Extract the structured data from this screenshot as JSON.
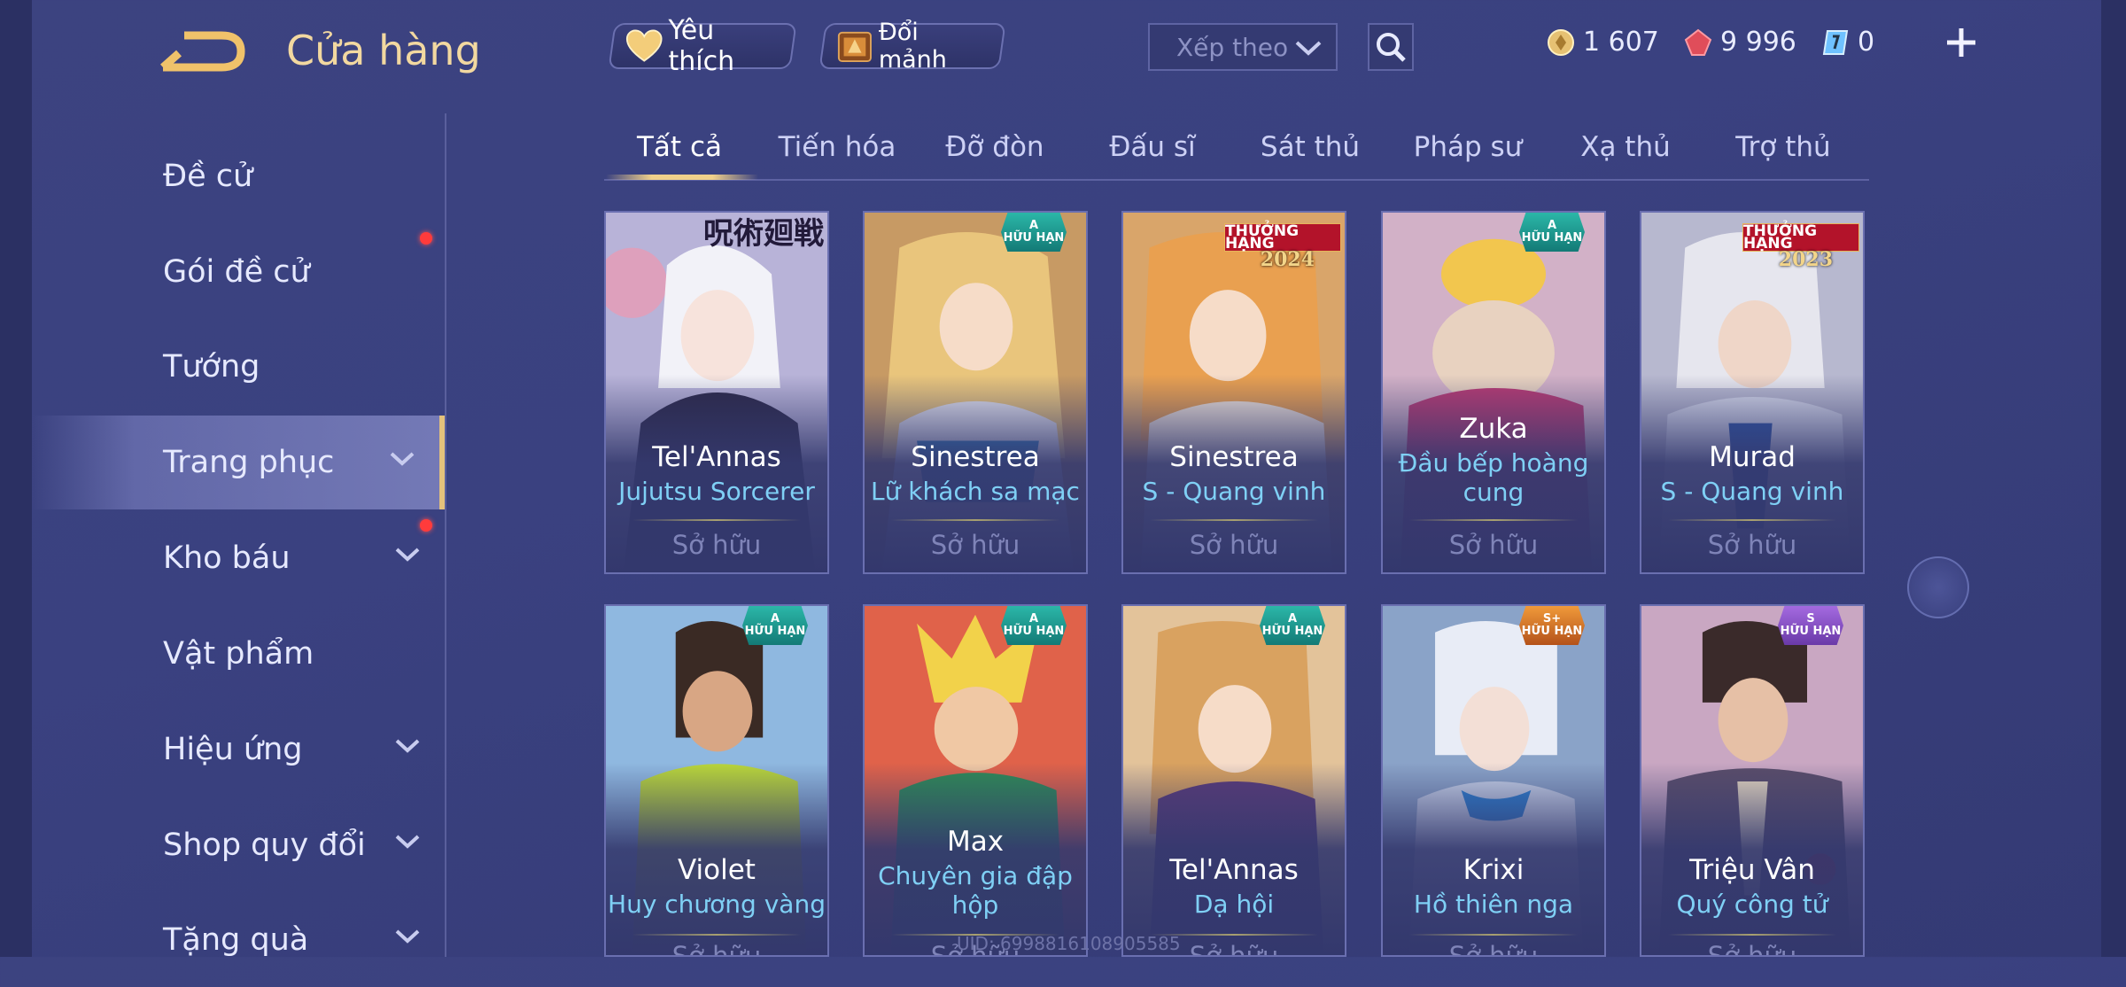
{
  "header": {
    "title": "Cửa hàng",
    "favorite_label": "Yêu thích",
    "shard_label": "Đổi mảnh",
    "sort_placeholder": "Xếp theo",
    "currencies": [
      {
        "name": "gold",
        "value": "1 607"
      },
      {
        "name": "ruby",
        "value": "9 996"
      },
      {
        "name": "voucher",
        "value": "0"
      }
    ]
  },
  "sidebar": {
    "items": [
      {
        "label": "Đề cử"
      },
      {
        "label": "Gói đề cử"
      },
      {
        "label": "Tướng"
      },
      {
        "label": "Trang phục"
      },
      {
        "label": "Kho báu"
      },
      {
        "label": "Vật phẩm"
      },
      {
        "label": "Hiệu ứng"
      },
      {
        "label": "Shop quy đổi"
      },
      {
        "label": "Tặng quà"
      }
    ],
    "active": "Trang phục"
  },
  "tabs": [
    "Tất cả",
    "Tiến hóa",
    "Đỡ đòn",
    "Đấu sĩ",
    "Sát thủ",
    "Pháp sư",
    "Xạ thủ",
    "Trợ thủ"
  ],
  "active_tab": "Tất cả",
  "cards": [
    {
      "hero": "Tel'Annas",
      "skin": "Jujutsu Sorcerer",
      "status": "Sở hữu",
      "badge_text": "呪術廻戦"
    },
    {
      "hero": "Sinestrea",
      "skin": "Lữ khách sa mạc",
      "status": "Sở hữu",
      "badge_tier": "A",
      "badge_label": "HỮU HẠN"
    },
    {
      "hero": "Sinestrea",
      "skin": "S - Quang vinh",
      "status": "Sở hữu",
      "badge_label": "THƯỞNG HẠNG",
      "badge_year": "2024"
    },
    {
      "hero": "Zuka",
      "skin": "Đầu bếp hoàng cung",
      "status": "Sở hữu",
      "badge_tier": "A",
      "badge_label": "HỮU HẠN"
    },
    {
      "hero": "Murad",
      "skin": "S - Quang vinh",
      "status": "Sở hữu",
      "badge_label": "THƯỞNG HẠNG",
      "badge_year": "2023"
    },
    {
      "hero": "Violet",
      "skin": "Huy chương vàng",
      "status": "Sở hữu",
      "badge_tier": "A",
      "badge_label": "HỮU HẠN"
    },
    {
      "hero": "Max",
      "skin": "Chuyên gia đập hộp",
      "status": "Sở hữu",
      "badge_tier": "A",
      "badge_label": "HỮU HẠN"
    },
    {
      "hero": "Tel'Annas",
      "skin": "Dạ hội",
      "status": "Sở hữu",
      "badge_tier": "A",
      "badge_label": "HỮU HẠN"
    },
    {
      "hero": "Krixi",
      "skin": "Hồ thiên nga",
      "status": "Sở hữu",
      "badge_tier": "S+",
      "badge_label": "HỮU HẠN"
    },
    {
      "hero": "Triệu Vân",
      "skin": "Quý công tử",
      "status": "Sở hữu",
      "badge_tier": "S",
      "badge_label": "HỮU HẠN"
    }
  ],
  "uid": "UID: 6998816108905585",
  "colors": {
    "accent_gold": "#f2d8a0",
    "skin_name": "#7fd0f5",
    "badge_limited": "#2bb7a8",
    "badge_ranked": "#b3132a"
  }
}
